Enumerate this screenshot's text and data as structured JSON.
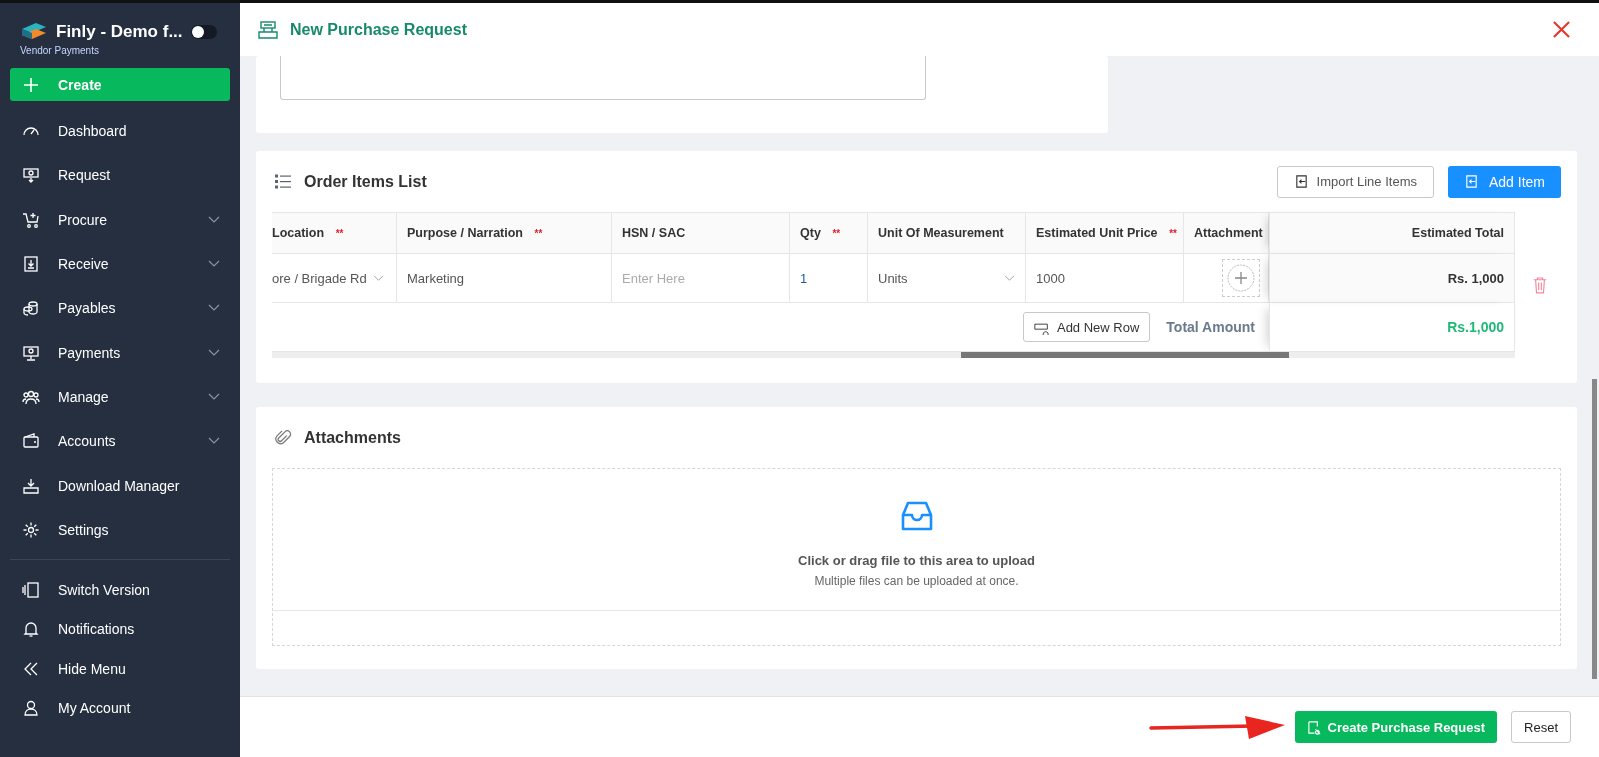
{
  "sidebar": {
    "brand": "Finly - Demo f...",
    "subtitle": "Vendor Payments",
    "toggle_on": false,
    "create": {
      "label": "Create"
    },
    "items": [
      {
        "label": "Dashboard",
        "expandable": false
      },
      {
        "label": "Request",
        "expandable": false
      },
      {
        "label": "Procure",
        "expandable": true
      },
      {
        "label": "Receive",
        "expandable": true
      },
      {
        "label": "Payables",
        "expandable": true
      },
      {
        "label": "Payments",
        "expandable": true
      },
      {
        "label": "Manage",
        "expandable": true
      },
      {
        "label": "Accounts",
        "expandable": true
      },
      {
        "label": "Download Manager",
        "expandable": false
      },
      {
        "label": "Settings",
        "expandable": false
      }
    ],
    "bottom_items": [
      {
        "label": "Switch Version"
      },
      {
        "label": "Notifications"
      },
      {
        "label": "Hide Menu"
      },
      {
        "label": "My Account"
      }
    ]
  },
  "header": {
    "title": "New Purchase Request"
  },
  "order_items": {
    "title": "Order Items List",
    "import_button": "Import Line Items",
    "add_button": "Add Item",
    "columns": [
      {
        "label": "Location",
        "mark": "**"
      },
      {
        "label": "Purpose / Narration",
        "mark": "**"
      },
      {
        "label": "HSN / SAC"
      },
      {
        "label": "Qty",
        "mark": "**"
      },
      {
        "label": "Unit Of Measurement"
      },
      {
        "label": "Estimated Unit Price",
        "mark": "**"
      },
      {
        "label": "Attachment"
      },
      {
        "label": "Estimated Total"
      }
    ],
    "rows": [
      {
        "location": "ore / Brigade Rd",
        "purpose": "Marketing",
        "hsn_placeholder": "Enter Here",
        "qty": "1",
        "unit": "Units",
        "unit_price": "1000",
        "total": "Rs. 1,000"
      }
    ],
    "add_row_button": "Add New Row",
    "total_label": "Total Amount",
    "total_value": "Rs.1,000"
  },
  "attachments": {
    "title": "Attachments",
    "hint": "Click or drag file to this area to upload",
    "subhint": "Multiple files can be uploaded at once."
  },
  "footer": {
    "submit_button": "Create Purchase Request",
    "reset_button": "Reset"
  }
}
